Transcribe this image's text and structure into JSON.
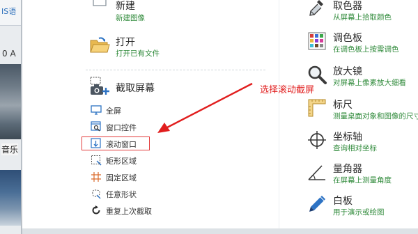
{
  "background_window": {
    "title_fragment": "IS语",
    "text1": "0 A",
    "text2": "音乐"
  },
  "left_column": {
    "new": {
      "title": "新建",
      "subtitle": "新建图像",
      "icon": "new-image-icon"
    },
    "open": {
      "title": "打开",
      "subtitle": "打开已有文件",
      "icon": "folder-open-icon"
    },
    "capture": {
      "title": "截取屏幕",
      "icon": "camera-plus-icon"
    },
    "capture_items": [
      {
        "label": "全屏",
        "icon": "monitor-icon"
      },
      {
        "label": "窗口控件",
        "icon": "window-search-icon"
      },
      {
        "label": "滚动窗口",
        "icon": "scroll-window-icon"
      },
      {
        "label": "矩形区域",
        "icon": "rectangle-select-icon"
      },
      {
        "label": "固定区域",
        "icon": "grid-icon"
      },
      {
        "label": "任意形状",
        "icon": "freeform-icon"
      },
      {
        "label": "重复上次截取",
        "icon": "repeat-icon"
      }
    ]
  },
  "right_column": [
    {
      "title": "取色器",
      "subtitle": "从屏幕上拾取颜色",
      "icon": "eyedropper-icon"
    },
    {
      "title": "调色板",
      "subtitle": "在调色板上按需调色",
      "icon": "palette-icon"
    },
    {
      "title": "放大镜",
      "subtitle": "对屏幕上像素放大细看",
      "icon": "magnifier-icon"
    },
    {
      "title": "标尺",
      "subtitle": "测量桌面对象和图像的尺寸",
      "icon": "ruler-icon"
    },
    {
      "title": "坐标轴",
      "subtitle": "查询相对坐标",
      "icon": "crosshair-icon"
    },
    {
      "title": "量角器",
      "subtitle": "在屏幕上测量角度",
      "icon": "protractor-icon"
    },
    {
      "title": "白板",
      "subtitle": "用于演示或绘图",
      "icon": "pen-icon"
    }
  ],
  "annotation": {
    "text": "选择滚动截屏",
    "color": "#e11d1d"
  },
  "colors": {
    "subtitle_green": "#2f8a3a",
    "highlight_red": "#e23b3b",
    "icon_blue": "#2d73c4"
  }
}
